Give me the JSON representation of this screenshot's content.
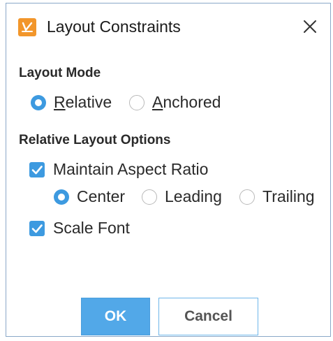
{
  "dialog": {
    "title": "Layout Constraints",
    "app_icon": "layout-constraints-icon",
    "close_icon": "close-icon"
  },
  "layout_mode": {
    "label": "Layout Mode",
    "options": [
      {
        "label_mnemonic": "R",
        "label_rest": "elative",
        "selected": true
      },
      {
        "label_mnemonic": "A",
        "label_rest": "nchored",
        "selected": false
      }
    ]
  },
  "relative_options": {
    "label": "Relative Layout Options",
    "maintain_aspect_ratio": {
      "label": "Maintain Aspect Ratio",
      "checked": true
    },
    "alignment": [
      {
        "label": "Center",
        "selected": true
      },
      {
        "label": "Leading",
        "selected": false
      },
      {
        "label": "Trailing",
        "selected": false
      }
    ],
    "scale_font": {
      "label": "Scale Font",
      "checked": true
    }
  },
  "buttons": {
    "ok_label": "OK",
    "cancel_label": "Cancel"
  },
  "colors": {
    "accent": "#3d9ae0",
    "ok_button": "#52a8e8",
    "app_icon": "#f2962b"
  }
}
